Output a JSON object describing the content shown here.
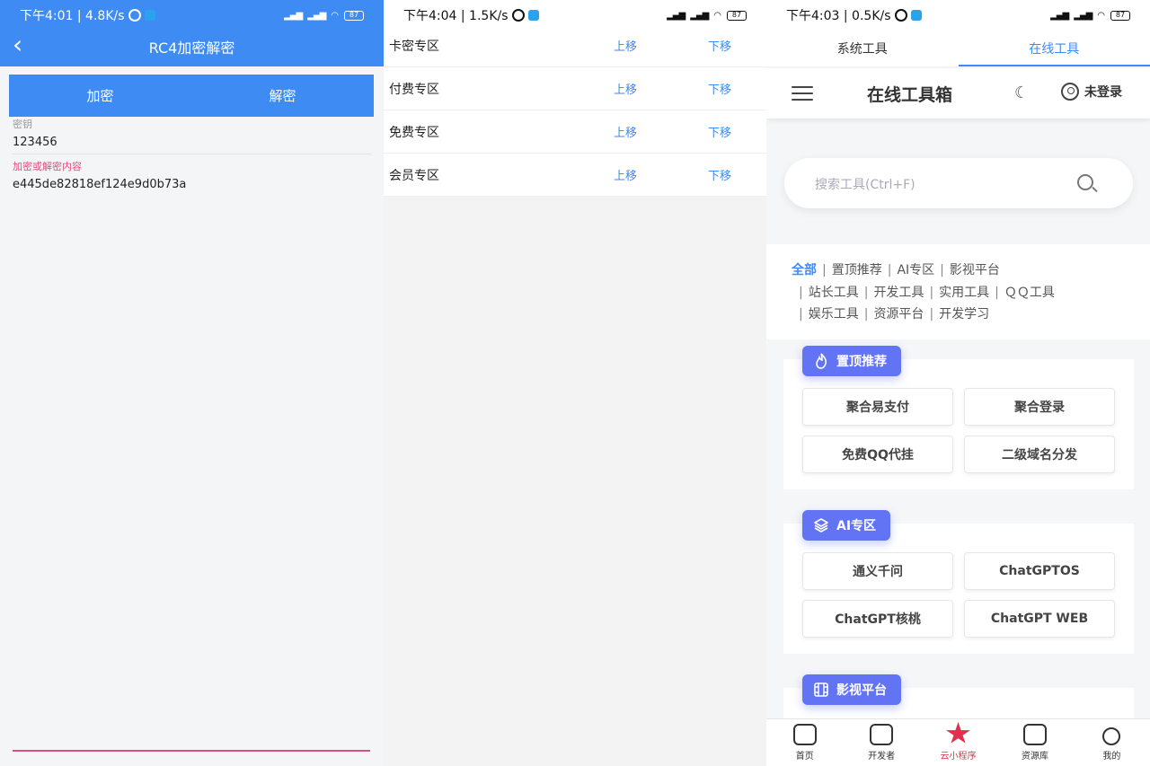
{
  "panel1": {
    "status": {
      "time": "下午4:01 | 4.8K/s",
      "battery": "87"
    },
    "title": "RC4加密解密",
    "tabs": [
      "加密",
      "解密"
    ],
    "key_label": "密钥",
    "key_value": "123456",
    "content_label": "加密或解密内容",
    "content_value": "e445de82818ef124e9d0b73a"
  },
  "panel2": {
    "status": {
      "time": "下午4:04 | 1.5K/s",
      "battery": "87"
    },
    "rows": [
      {
        "name": "卡密专区",
        "up": "上移",
        "down": "下移"
      },
      {
        "name": "付费专区",
        "up": "上移",
        "down": "下移"
      },
      {
        "name": "免费专区",
        "up": "上移",
        "down": "下移"
      },
      {
        "name": "会员专区",
        "up": "上移",
        "down": "下移"
      }
    ]
  },
  "panel3": {
    "status": {
      "time": "下午4:03 | 0.5K/s",
      "battery": "87"
    },
    "tabs": [
      "系统工具",
      "在线工具"
    ],
    "header_title": "在线工具箱",
    "login_label": "未登录",
    "search_placeholder": "搜索工具(Ctrl+F)",
    "categories": {
      "line1": [
        "全部",
        "置顶推荐",
        "AI专区",
        "影视平台"
      ],
      "line2": [
        "站长工具",
        "开发工具",
        "实用工具",
        "ＱＱ工具"
      ],
      "line3": [
        "娱乐工具",
        "资源平台",
        "开发学习"
      ]
    },
    "sections": [
      {
        "title": "置顶推荐",
        "tools": [
          "聚合易支付",
          "聚合登录",
          "免费QQ代挂",
          "二级域名分发"
        ]
      },
      {
        "title": "AI专区",
        "tools": [
          "通义千问",
          "ChatGPTOS",
          "ChatGPT核桃",
          "ChatGPT WEB"
        ]
      },
      {
        "title": "影视平台",
        "tools": []
      }
    ],
    "tabbar": [
      "首页",
      "开发者",
      "云小程序",
      "资源库",
      "我的"
    ],
    "accent": "#3d8bf3",
    "badge_color": "#6274f4",
    "active_tab_color": "#e0304c"
  }
}
